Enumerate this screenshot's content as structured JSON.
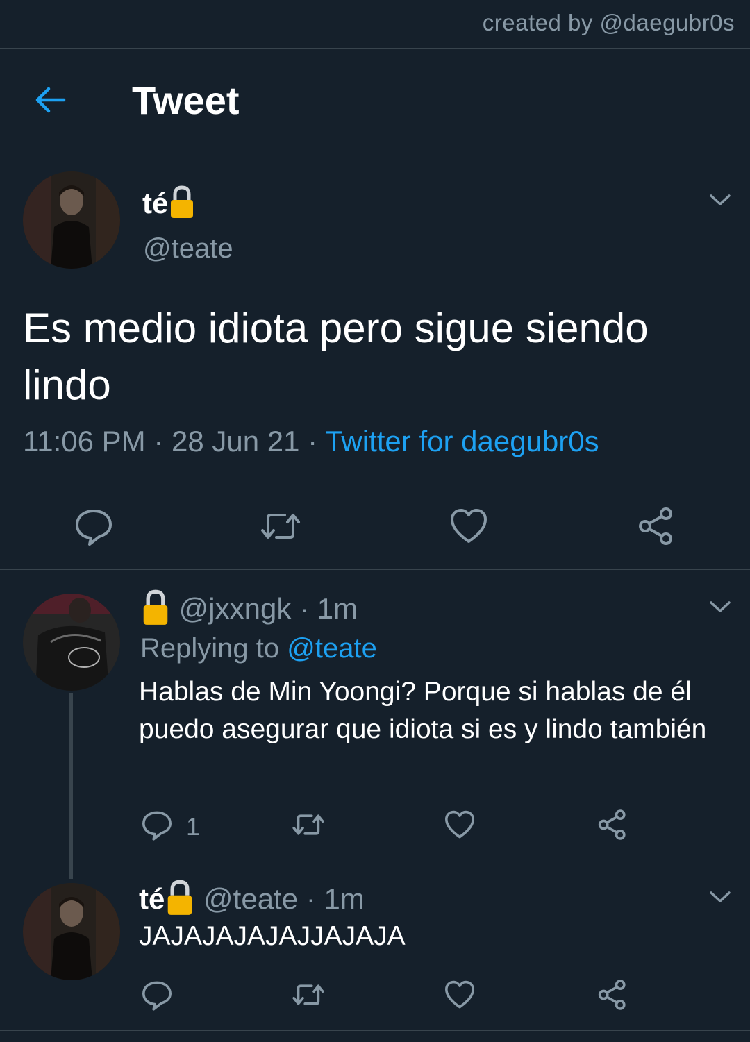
{
  "watermark": "created by @daegubr0s",
  "header": {
    "title": "Tweet"
  },
  "tweet": {
    "name": "té",
    "handle": "@teate",
    "text": "Es medio idiota pero sigue siendo lindo",
    "time": "11:06 PM",
    "date": "28 Jun 21",
    "source": "Twitter for daegubr0s",
    "separator": "·"
  },
  "replies": [
    {
      "handle": "@jxxngk",
      "time": "1m",
      "replying_label": "Replying to",
      "replying_to": "@teate",
      "text": "Hablas de Min Yoongi? Porque si hablas de él puedo asegurar que idiota si es y lindo también",
      "reply_count": "1"
    },
    {
      "name": "té",
      "handle": "@teate",
      "time": "1m",
      "text": "JAJAJAJAJAJJAJAJA"
    }
  ],
  "icons": {
    "back": "arrow-left-icon",
    "lock": "lock-icon",
    "reply": "reply-icon",
    "retweet": "retweet-icon",
    "like": "heart-icon",
    "share": "share-icon",
    "more": "chevron-down-icon"
  },
  "colors": {
    "background": "#15202b",
    "accent": "#1da1f2",
    "secondary_text": "#8899a6",
    "divider": "#38444d"
  }
}
